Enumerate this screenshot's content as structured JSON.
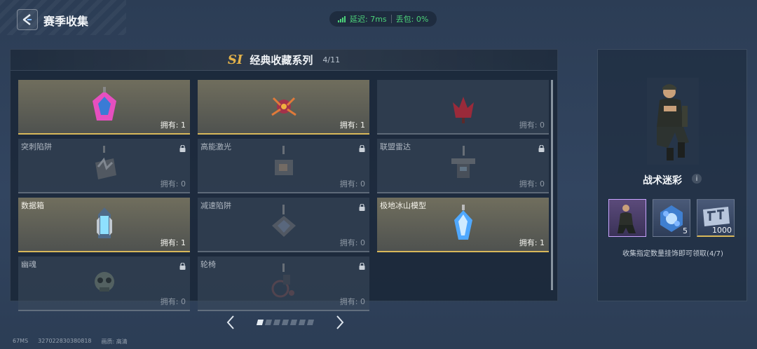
{
  "header": {
    "title": "赛季收集",
    "latency_label": "延迟: 7ms",
    "packet_loss_label": "丢包: 0%"
  },
  "series": {
    "badge": "SI",
    "title": "经典收藏系列",
    "progress": "4/11"
  },
  "items": [
    {
      "name": "",
      "count": "拥有: 1",
      "owned": true,
      "locked": false,
      "icon": "pink-crystal-charm"
    },
    {
      "name": "",
      "count": "拥有: 1",
      "owned": true,
      "locked": false,
      "icon": "spider-mech-charm"
    },
    {
      "name": "",
      "count": "拥有: 0",
      "owned": false,
      "locked": false,
      "icon": "red-flower-charm"
    },
    {
      "name": "突刺陷阱",
      "count": "拥有: 0",
      "owned": false,
      "locked": true,
      "icon": "spike-trap-charm"
    },
    {
      "name": "高能激光",
      "count": "拥有: 0",
      "owned": false,
      "locked": true,
      "icon": "laser-charm"
    },
    {
      "name": "联盟雷达",
      "count": "拥有: 0",
      "owned": false,
      "locked": true,
      "icon": "radar-charm"
    },
    {
      "name": "数据箱",
      "count": "拥有: 1",
      "owned": true,
      "locked": false,
      "icon": "data-box-charm"
    },
    {
      "name": "减速陷阱",
      "count": "拥有: 0",
      "owned": false,
      "locked": true,
      "icon": "slow-trap-charm"
    },
    {
      "name": "极地冰山模型",
      "count": "拥有: 1",
      "owned": true,
      "locked": false,
      "icon": "iceberg-charm"
    },
    {
      "name": "幽魂",
      "count": "拥有: 0",
      "owned": false,
      "locked": true,
      "icon": "ghost-skull-charm"
    },
    {
      "name": "轮椅",
      "count": "拥有: 0",
      "owned": false,
      "locked": true,
      "icon": "wheelchair-charm"
    }
  ],
  "pager": {
    "pages": 7,
    "current": 1
  },
  "reward": {
    "name": "战术迷彩",
    "items": [
      {
        "icon": "character-skin-icon",
        "qty": ""
      },
      {
        "icon": "blue-orb-crate-icon",
        "qty": "5"
      },
      {
        "icon": "voucher-ticket-icon",
        "qty": "1000"
      }
    ],
    "claim_text": "收集指定数量挂饰即可领取(4/7)"
  },
  "footer": {
    "fps": "67MS",
    "player_id": "327022830380818",
    "quality_label": "画质:",
    "quality_value": "高清"
  },
  "colors": {
    "accent_gold": "#d8b85a",
    "latency_green": "#4cd37a",
    "selected_purple": "#c9a4ff"
  }
}
